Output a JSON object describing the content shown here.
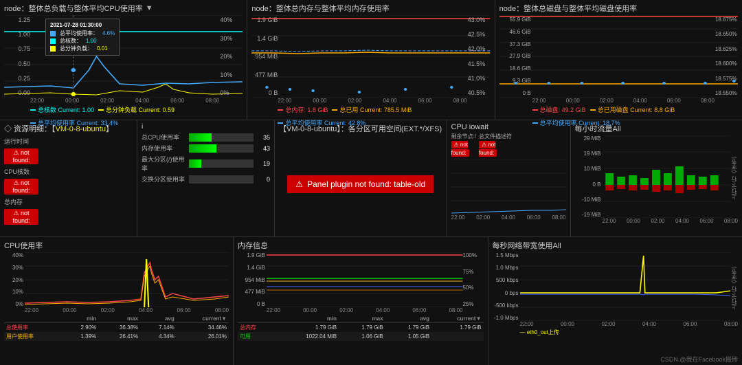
{
  "top": {
    "panel1": {
      "title": "node：整体总负载与整体平均CPU使用率",
      "leftAxis": [
        "1.25",
        "1.00",
        "0.75",
        "0.50",
        "0.25",
        "0.00"
      ],
      "rightAxis": [
        "40%",
        "30%",
        "20%",
        "10%",
        "0%"
      ],
      "xLabels": [
        "22:00",
        "00:00",
        "02:00",
        "04:00",
        "06:00",
        "08:00"
      ],
      "legend": [
        {
          "label": "总核数 Current: 1.00",
          "color": "#0ff"
        },
        {
          "label": "总分钟负载 Current: 0.59",
          "color": "#ff0"
        },
        {
          "label": "总平均使用率 Current: 33.4%",
          "color": "#44aaff"
        }
      ],
      "tooltip": {
        "title": "2021-07-28 01:30:00",
        "rows": [
          {
            "color": "#44aaff",
            "label": "总平均使用率：",
            "value": "4.6%"
          },
          {
            "color": "#0ff",
            "label": "总核数：",
            "value": "1.00"
          },
          {
            "color": "#ff0",
            "label": "总分钟负载：",
            "value": "0.01"
          }
        ]
      }
    },
    "panel2": {
      "title": "node：整体总内存与整体平均内存使用率",
      "leftAxis": [
        "1.9 GiB",
        "1.4 GiB",
        "954 MiB",
        "477 MiB",
        "0 B"
      ],
      "rightAxis": [
        "43.0%",
        "42.5%",
        "42.0%",
        "41.5%",
        "41.0%",
        "40.5%"
      ],
      "xLabels": [
        "22:00",
        "00:00",
        "02:00",
        "04:00",
        "06:00",
        "08:00"
      ],
      "legend": [
        {
          "label": "总内存: 1.8 GiB",
          "color": "#ff4444"
        },
        {
          "label": "总已用 Current: 785.5 MiB",
          "color": "#ffaa00"
        },
        {
          "label": "总平均使用率 Current: 42.8%",
          "color": "#44aaff"
        }
      ]
    },
    "panel3": {
      "title": "node：整体总磁盘与整体平均磁盘使用率",
      "leftAxis": [
        "55.9 GiB",
        "46.6 GiB",
        "37.3 GiB",
        "27.9 GiB",
        "18.6 GiB",
        "9.3 GiB",
        "0 B"
      ],
      "rightAxis": [
        "18.675%",
        "18.650%",
        "18.625%",
        "18.600%",
        "18.575%",
        "18.550%"
      ],
      "xLabels": [
        "22:00",
        "00:00",
        "02:00",
        "04:00",
        "06:00",
        "08:00"
      ],
      "legend": [
        {
          "label": "总磁盘: 49.2 GiB",
          "color": "#ff4444"
        },
        {
          "label": "总已用磁盘 Current: 8.8 GiB",
          "color": "#ffaa00"
        },
        {
          "label": "总平均使用率 Current: 18.7%",
          "color": "#44aaff"
        }
      ]
    }
  },
  "middle": {
    "resourceLabel": {
      "prefix": "◇ 资源明细：【",
      "name": "VM-0-8-ubuntu",
      "suffix": "】"
    },
    "metrics": [
      {
        "label": "运行时间",
        "status": "not found:"
      },
      {
        "label": "CPU核数",
        "status": "not found:"
      },
      {
        "label": "总内存",
        "status": "not found:"
      }
    ],
    "usagePanel": {
      "title": "i",
      "bars": [
        {
          "label": "总CPU使用率",
          "value": 35,
          "pct": 35
        },
        {
          "label": "内存使用率",
          "value": 43,
          "pct": 43
        },
        {
          "label": "最大分区(/)使用率",
          "value": 19,
          "pct": 19
        },
        {
          "label": "交换分区使用率",
          "value": 0,
          "pct": 0
        }
      ]
    },
    "diskPanel": {
      "title": "【VM-0-8-ubuntu】：各分区可用空间(EXT.*/XFS)",
      "error": "⚠ Panel plugin not found: table-old"
    },
    "iowaitPanel": {
      "title": "CPU iowait",
      "metrics": [
        {
          "label": "剩余节点:/",
          "status": "not found:"
        },
        {
          "label": "总文件描述符",
          "status": "not found:"
        }
      ],
      "xLabels": [
        "22:00",
        "02:00",
        "04:00",
        "06:00",
        "08:00"
      ]
    },
    "trafficPanel": {
      "title": "每小时流量All",
      "xLabels": [
        "22:00",
        "00:00",
        "02:00",
        "04:00",
        "06:00",
        "08:00"
      ],
      "yLabels": [
        "29 MiB",
        "19 MiB",
        "10 MiB",
        "0 B",
        "-10 MiB",
        "-19 MiB"
      ],
      "yAxisLabel": "上行/下行（/字节）"
    }
  },
  "bottom": {
    "cpuPanel": {
      "title": "CPU使用率",
      "xLabels": [
        "22:00",
        "00:00",
        "02:00",
        "04:00",
        "06:00",
        "08:00"
      ],
      "yLabels": [
        "40%",
        "30%",
        "20%",
        "10%",
        "0%"
      ],
      "table": {
        "headers": [
          "",
          "min",
          "max",
          "avg",
          "current▼"
        ],
        "rows": [
          {
            "label": "总使用率",
            "min": "2.90%",
            "max": "36.38%",
            "avg": "7.14%",
            "current": "34.46%",
            "color": "#ff4444"
          },
          {
            "label": "用户使用率",
            "min": "1.39%",
            "max": "26.41%",
            "avg": "4.34%",
            "current": "26.01%",
            "color": "#ffaa00"
          }
        ]
      }
    },
    "memPanel": {
      "title": "内存信息",
      "xLabels": [
        "22:00",
        "00:00",
        "02:00",
        "04:00",
        "06:00",
        "08:00"
      ],
      "yLabels": [
        "1.9 GiB",
        "1.4 GiB",
        "954 MiB",
        "477 MiB",
        "0 B"
      ],
      "rightAxis": [
        "100%",
        "75%",
        "50%",
        "25%"
      ],
      "table": {
        "headers": [
          "",
          "min",
          "max",
          "avg",
          "current▼"
        ],
        "rows": [
          {
            "label": "总内存",
            "min": "1.79 GiB",
            "max": "1.79 GiB",
            "avg": "1.79 GiB",
            "current": "1.79 GiB",
            "color": "#ff4444"
          },
          {
            "label": "可用",
            "min": "1022.04 MiB",
            "max": "1.06 GiB",
            "avg": "1.05 GiB",
            "current": "",
            "color": "#00cc00"
          }
        ]
      }
    },
    "networkPanel": {
      "title": "每秒网络带宽使用All",
      "xLabels": [
        "22:00",
        "00:00",
        "02:00",
        "04:00",
        "06:00",
        "08:00"
      ],
      "yLabels": [
        "1.5 Mbps",
        "1.0 Mbps",
        "500 kbps",
        "0 bps",
        "-500 kbps",
        "-1.0 Mbps"
      ],
      "yAxisLabel": "上行/下行（/字节）",
      "legend": "eth0_out上传",
      "watermark": "CSDN.@我在Facebook搬砖"
    }
  }
}
